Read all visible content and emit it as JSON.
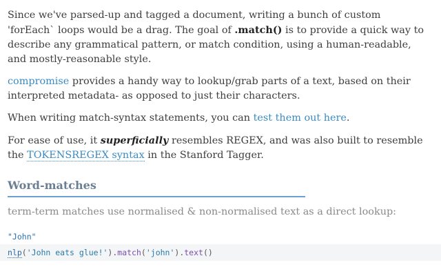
{
  "paragraphs": {
    "p1": {
      "text_a": "Since we've parsed-up and tagged a document, writing a bunch of custom 'forEach` loops would be a drag. The goal of ",
      "bold": ".match()",
      "text_b": " is to provide a quick way to describe any grammatical pattern, or match condition, using a human-readable, and mostly-reasonable style."
    },
    "p2": {
      "link": "compromise",
      "text": " provides a handy way to lookup/grab parts of a text, based on their interpreted metadata- as opposed to just their characters."
    },
    "p3": {
      "text": "When writing match-syntax statements, you can ",
      "link": "test them out here",
      "end": "."
    },
    "p4": {
      "text_a": "For ease of use, it ",
      "italic": "superficially",
      "text_b": " resembles REGEX, and was also built to resemble the ",
      "link": "TOKENSREGEX syntax",
      "text_c": " in the Stanford Tagger."
    }
  },
  "section": {
    "title": "Word-matches",
    "subtitle": "term-term matches use normalised & non-normalised text as a direct lookup:"
  },
  "code": {
    "result": "\"John\"",
    "fn": "nlp",
    "open1": "(",
    "arg1": "'John eats glue!'",
    "close1": ").",
    "method1": "match",
    "open2": "(",
    "arg2": "'john'",
    "close2": ").",
    "method2": "text",
    "tail": "()"
  },
  "colors": {
    "link": "#3a8bc4",
    "section_rule": "#6aa0d2",
    "code_bg": "#f4f5f7"
  }
}
